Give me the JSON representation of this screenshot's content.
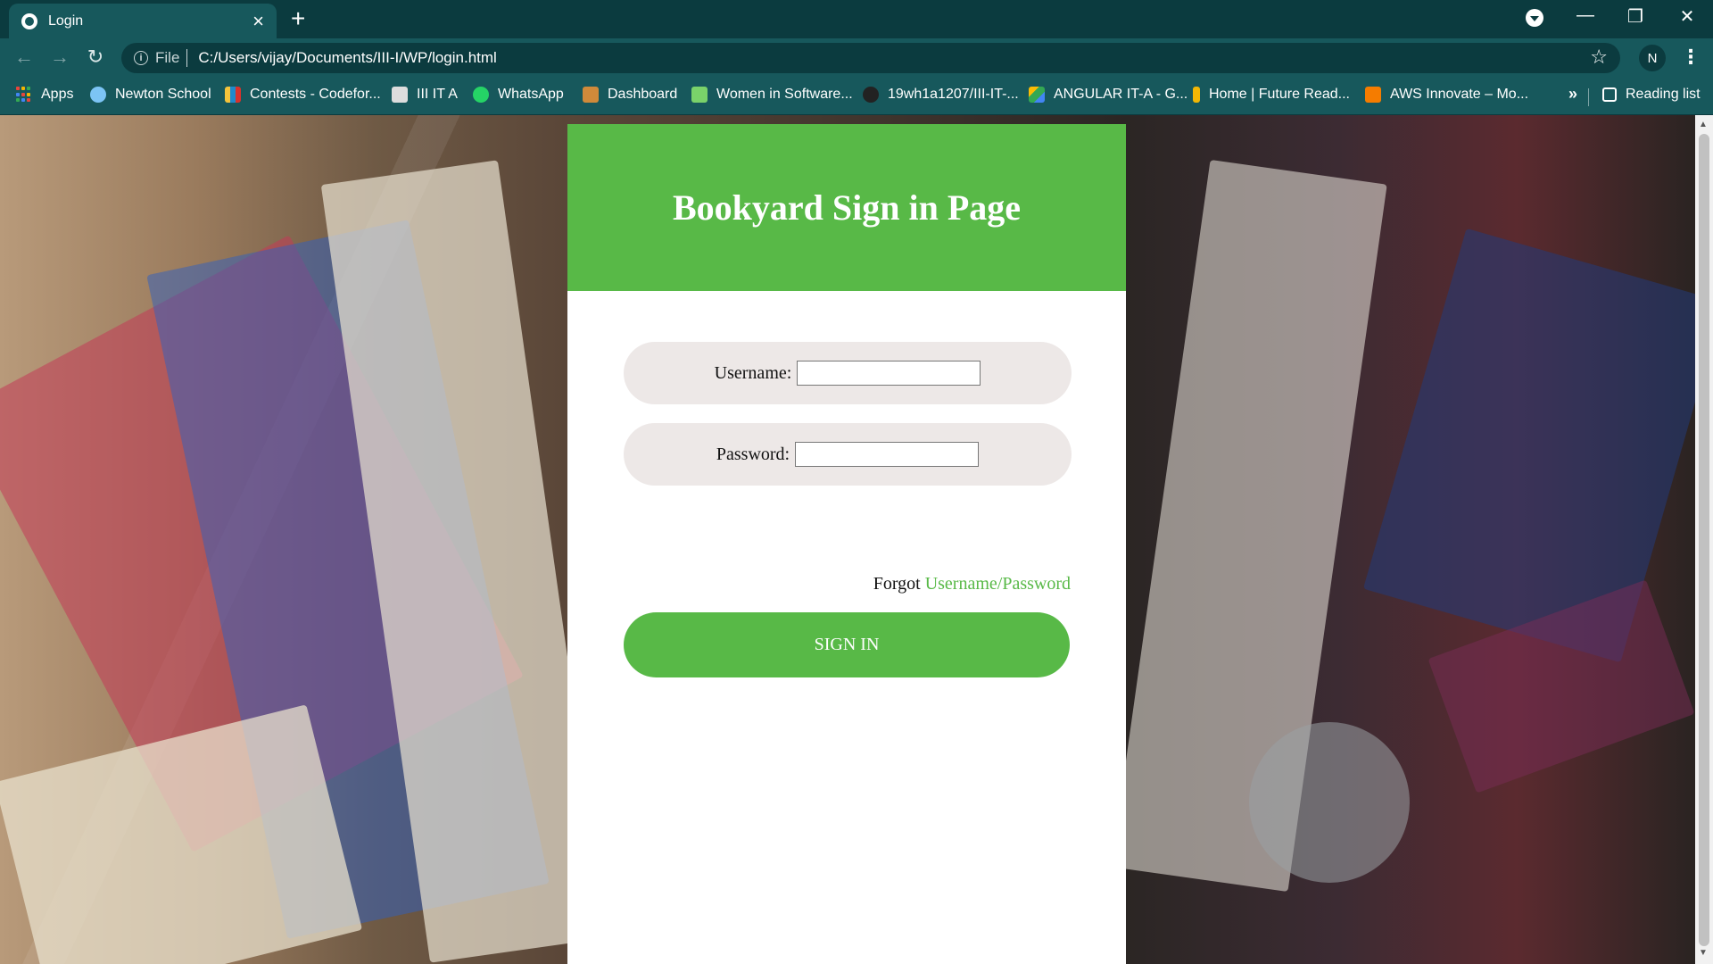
{
  "browser": {
    "tab_title": "Login",
    "tab_close": "×",
    "new_tab": "+",
    "url_scheme": "File",
    "url": "C:/Users/vijay/Documents/III-I/WP/login.html",
    "profile_initial": "N",
    "window_controls": {
      "minimize": "—",
      "restore": "❐",
      "close": "✕"
    },
    "bookmarks": [
      {
        "label": "Apps",
        "icon": "apps-grid-icon",
        "color": "#e8453c"
      },
      {
        "label": "Newton School",
        "icon": "newton-school-icon",
        "color": "#7cc4f5"
      },
      {
        "label": "Contests - Codefor...",
        "icon": "codeforces-icon",
        "color": "#f5c33b"
      },
      {
        "label": "III IT A",
        "icon": "classroom-icon",
        "color": "#dddddd"
      },
      {
        "label": "WhatsApp",
        "icon": "whatsapp-icon",
        "color": "#25d366"
      },
      {
        "label": "Dashboard",
        "icon": "dashboard-icon",
        "color": "#d08a3a"
      },
      {
        "label": "Women in Software...",
        "icon": "women-in-software-icon",
        "color": "#7ad26a"
      },
      {
        "label": "19wh1a1207/III-IT-...",
        "icon": "github-icon",
        "color": "#222222"
      },
      {
        "label": "ANGULAR IT-A - G...",
        "icon": "google-drive-icon",
        "color": "#34a853"
      },
      {
        "label": "Home | Future Read...",
        "icon": "future-ready-icon",
        "color": "#f2b705"
      },
      {
        "label": "AWS Innovate – Mo...",
        "icon": "aws-icon",
        "color": "#f57c00"
      }
    ],
    "more_bookmarks": "»",
    "reading_list": "Reading list"
  },
  "login": {
    "title": "Bookyard Sign in Page",
    "username_label": "Username:",
    "username_value": "",
    "password_label": "Password:",
    "password_value": "",
    "forgot_prefix": "Forgot",
    "forgot_link": "Username/Password",
    "signin_label": "SIGN IN"
  },
  "colors": {
    "accent_green": "#58b947",
    "field_bg": "#ede8e7",
    "chrome_dark": "#0b3b3f",
    "chrome_mid": "#17585c"
  }
}
